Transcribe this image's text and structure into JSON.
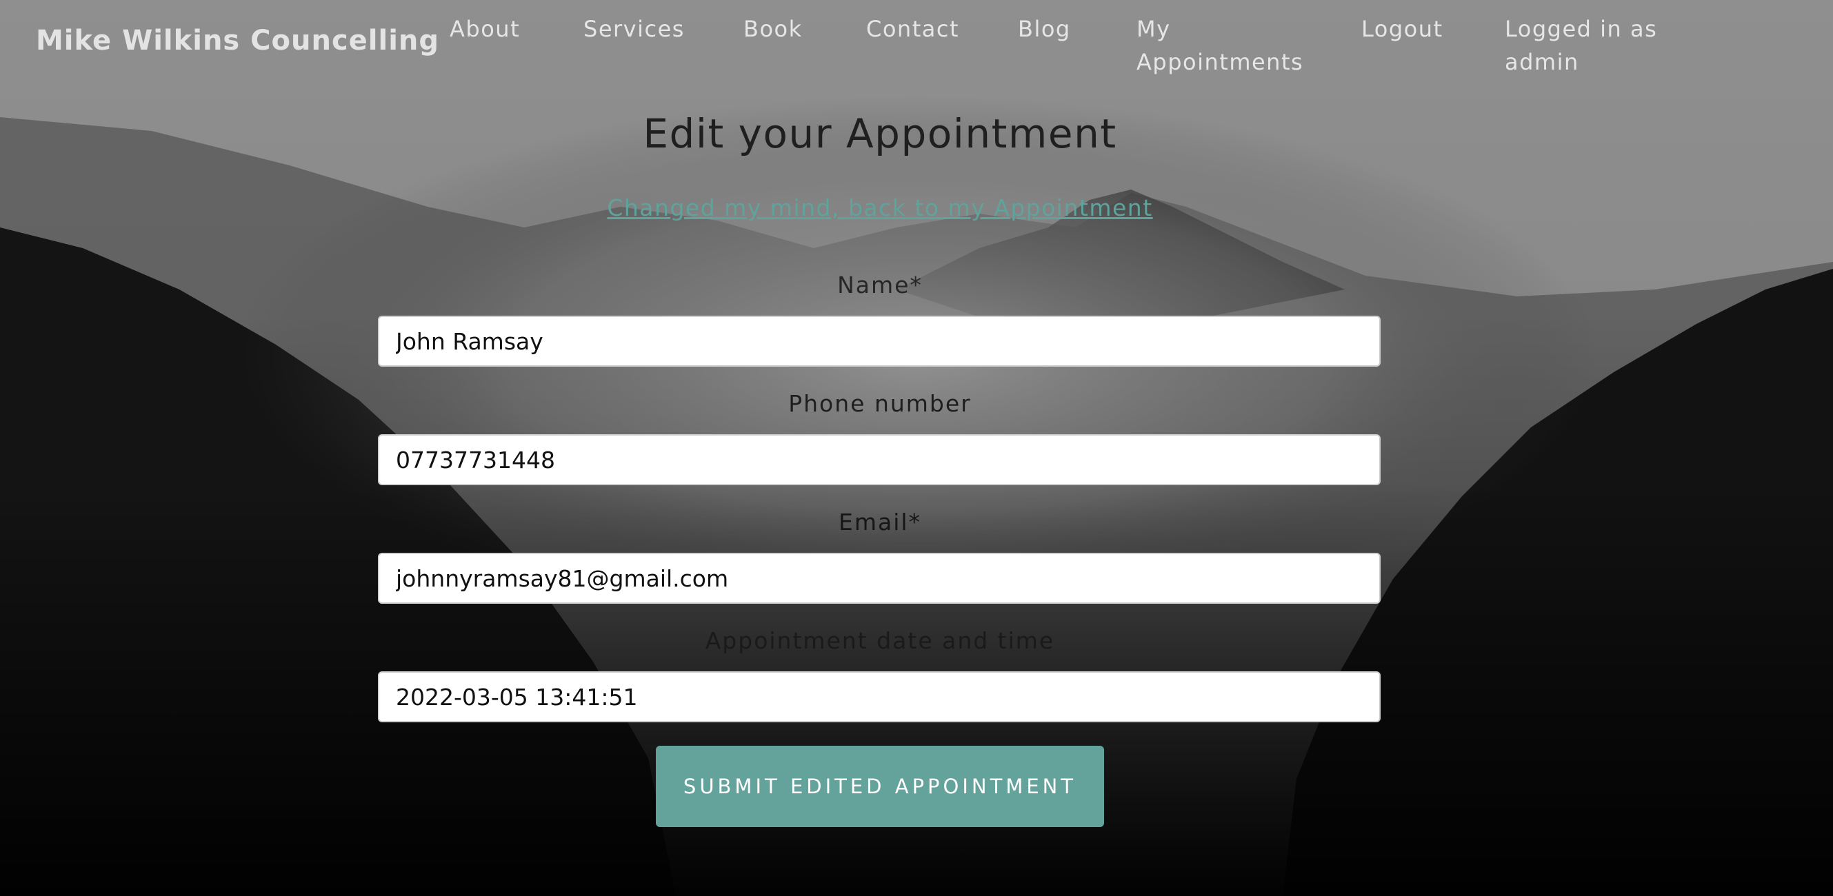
{
  "navbar": {
    "brand": "Mike Wilkins Councelling",
    "links": [
      {
        "label": "About"
      },
      {
        "label": "Services"
      },
      {
        "label": "Book"
      },
      {
        "label": "Contact"
      },
      {
        "label": "Blog"
      },
      {
        "label": "My Appointments"
      },
      {
        "label": "Logout"
      }
    ],
    "status": "Logged in as admin"
  },
  "page": {
    "title": "Edit your Appointment",
    "back_link": "Changed my mind, back to my Appointment"
  },
  "form": {
    "name": {
      "label": "Name*",
      "value": "John Ramsay"
    },
    "phone": {
      "label": "Phone number",
      "value": "07737731448"
    },
    "email": {
      "label": "Email*",
      "value": "johnnyramsay81@gmail.com"
    },
    "datetime": {
      "label": "Appointment date and time",
      "value": "2022-03-05 13:41:51"
    },
    "submit_label": "SUBMIT EDITED APPOINTMENT"
  },
  "colors": {
    "accent": "#64a39b",
    "link": "#5fa39c",
    "text_dark": "#1f1f1f",
    "nav_text": "#e6e6e6"
  }
}
